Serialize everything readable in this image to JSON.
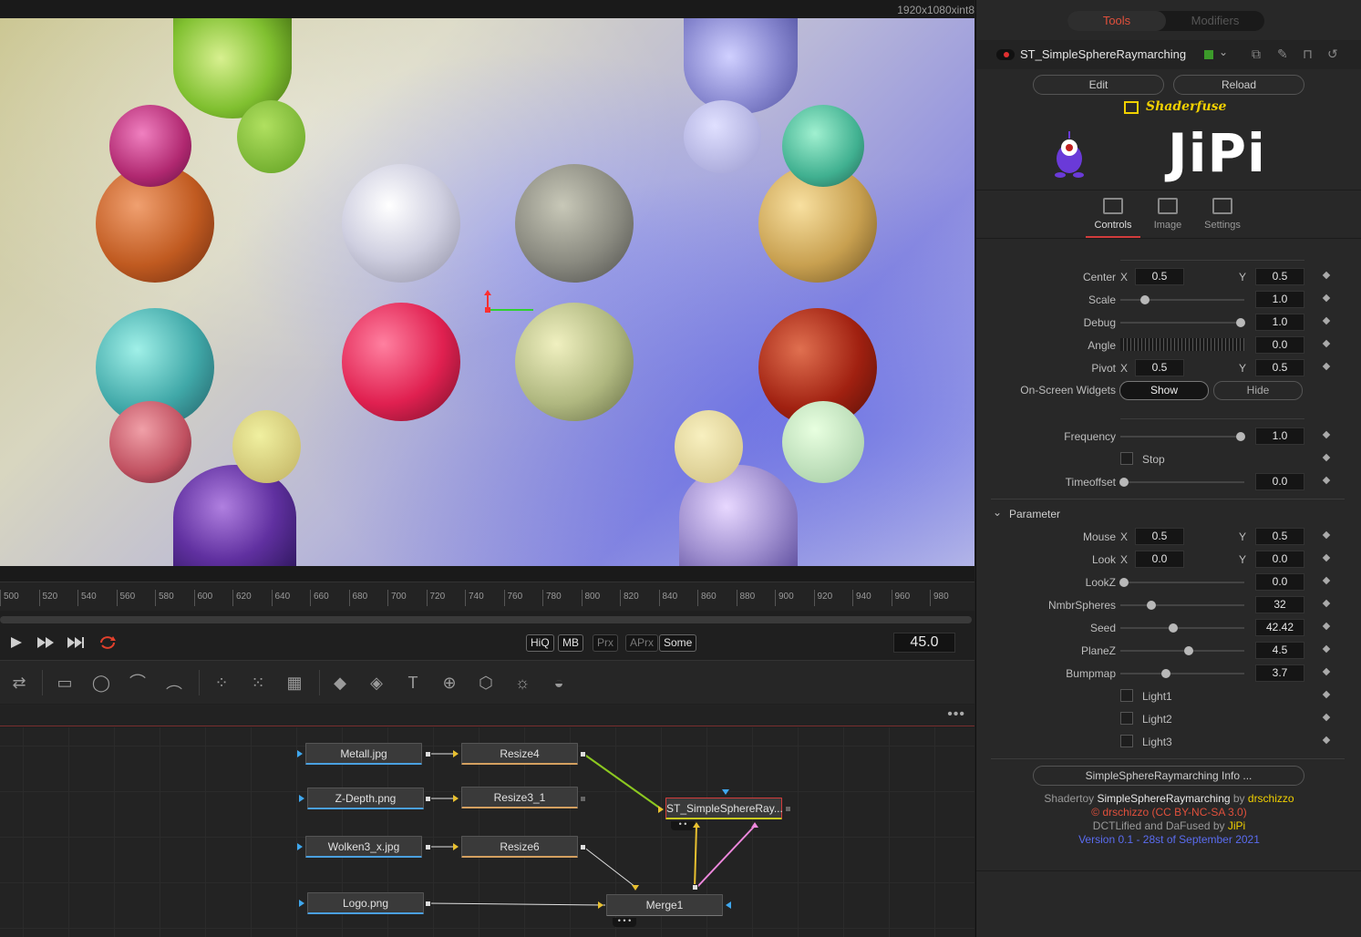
{
  "viewer": {
    "resolution": "1920x1080xint8"
  },
  "timeline": {
    "ticks": [
      "500",
      "520",
      "540",
      "560",
      "580",
      "600",
      "620",
      "640",
      "660",
      "680",
      "700",
      "720",
      "740",
      "760",
      "780",
      "800",
      "820",
      "840",
      "860",
      "880",
      "900",
      "920",
      "940",
      "960",
      "980"
    ],
    "current_frame": "45.0",
    "quality_buttons": [
      "HiQ",
      "MB",
      "Prx",
      "APrx",
      "Some"
    ]
  },
  "flow": {
    "nodes": {
      "metall": "Metall.jpg",
      "zdepth": "Z-Depth.png",
      "wolken": "Wolken3_x.jpg",
      "logo": "Logo.png",
      "resize4": "Resize4",
      "resize3": "Resize3_1",
      "resize6": "Resize6",
      "st": "ST_SimpleSphereRay...",
      "merge": "Merge1"
    },
    "menu": "•••"
  },
  "inspector": {
    "tabs": {
      "tools": "Tools",
      "modifiers": "Modifiers"
    },
    "tool_name": "ST_SimpleSphereRaymarching",
    "edit": "Edit",
    "reload": "Reload",
    "shaderfuse": "Shaderfuse",
    "author_logo": "JiPi",
    "pages": {
      "controls": "Controls",
      "image": "Image",
      "settings": "Settings"
    },
    "params": {
      "center": {
        "label": "Center",
        "x_label": "X",
        "x": "0.5",
        "y_label": "Y",
        "y": "0.5"
      },
      "scale": {
        "label": "Scale",
        "value": "1.0",
        "pos": 0.2
      },
      "debug": {
        "label": "Debug",
        "value": "1.0",
        "pos": 0.97
      },
      "angle": {
        "label": "Angle",
        "value": "0.0"
      },
      "pivot": {
        "label": "Pivot",
        "x_label": "X",
        "x": "0.5",
        "y_label": "Y",
        "y": "0.5"
      },
      "widgets": {
        "label": "On-Screen Widgets",
        "show": "Show",
        "hide": "Hide"
      },
      "frequency": {
        "label": "Frequency",
        "value": "1.0",
        "pos": 0.97
      },
      "stop": {
        "label": "Stop"
      },
      "timeoffset": {
        "label": "Timeoffset",
        "value": "0.0",
        "pos": 0.03
      }
    },
    "section": "Parameter",
    "section_params": {
      "mouse": {
        "label": "Mouse",
        "x_label": "X",
        "x": "0.5",
        "y_label": "Y",
        "y": "0.5"
      },
      "look": {
        "label": "Look",
        "x_label": "X",
        "x": "0.0",
        "y_label": "Y",
        "y": "0.0"
      },
      "lookz": {
        "label": "LookZ",
        "value": "0.0",
        "pos": 0.03
      },
      "nmbr": {
        "label": "NmbrSpheres",
        "value": "32",
        "pos": 0.25
      },
      "seed": {
        "label": "Seed",
        "value": "42.42",
        "pos": 0.43
      },
      "planez": {
        "label": "PlaneZ",
        "value": "4.5",
        "pos": 0.55
      },
      "bumpmap": {
        "label": "Bumpmap",
        "value": "3.7",
        "pos": 0.37
      },
      "light1": "Light1",
      "light2": "Light2",
      "light3": "Light3"
    },
    "info_button": "SimpleSphereRaymarching Info ...",
    "credits": {
      "line1_a": "Shadertoy ",
      "line1_b": "SimpleSphereRaymarching",
      "line1_c": " by ",
      "line1_d": "drschizzo",
      "line2": "© drschizzo (CC BY-NC-SA 3.0)",
      "line3_a": "DCTLified and DaFused by ",
      "line3_b": "JiPi",
      "line4": "Version 0.1 - 28st of September 2021"
    }
  },
  "colors": {
    "accent": "#d23c3c",
    "credit_yellow": "#f0d000",
    "credit_red": "#e0503c",
    "credit_blue": "#5a6cf0"
  }
}
